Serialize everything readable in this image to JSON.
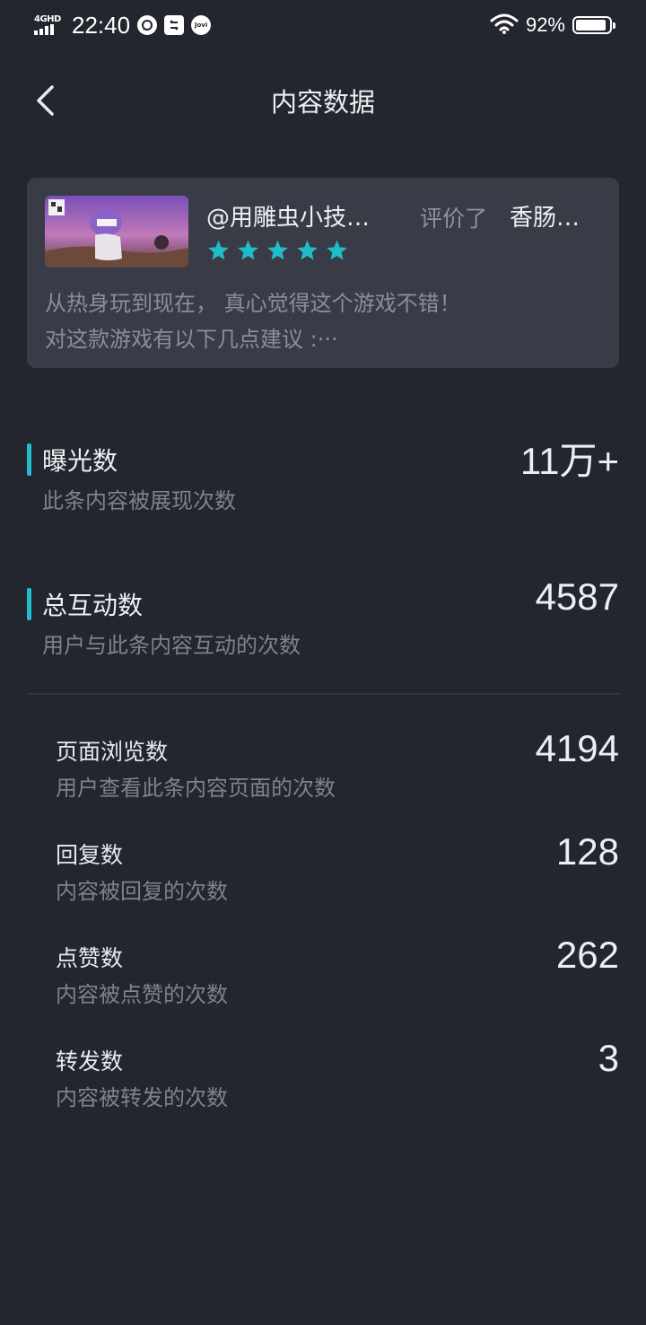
{
  "status_bar": {
    "network": "4GHD",
    "time": "22:40",
    "app_icons": [
      "messenger-icon",
      "sync-icon",
      "jovi-icon"
    ],
    "jovi_label": "Jovi",
    "battery_percent": "92%",
    "battery_level": 0.92
  },
  "header": {
    "title": "内容数据"
  },
  "review_card": {
    "user": "@用雕虫小技…",
    "action": "评价了",
    "game": "香肠…",
    "rating": 5,
    "rating_max": 5,
    "text_line1": "从热身玩到现在， 真心觉得这个游戏不错！",
    "text_line2": "对这款游戏有以下几点建议 :···"
  },
  "metrics": {
    "exposure": {
      "label": "曝光数",
      "desc": "此条内容被展现次数",
      "value": "11万+"
    },
    "interactions": {
      "label": "总互动数",
      "desc": "用户与此条内容互动的次数",
      "value": "4587"
    }
  },
  "breakdown": [
    {
      "label": "页面浏览数",
      "desc": "用户查看此条内容页面的次数",
      "value": "4194"
    },
    {
      "label": "回复数",
      "desc": "内容被回复的次数",
      "value": "128"
    },
    {
      "label": "点赞数",
      "desc": "内容被点赞的次数",
      "value": "262"
    },
    {
      "label": "转发数",
      "desc": "内容被转发的次数",
      "value": "3"
    }
  ],
  "colors": {
    "background": "#24262f",
    "card": "#393b47",
    "accent": "#1fbcc9"
  }
}
